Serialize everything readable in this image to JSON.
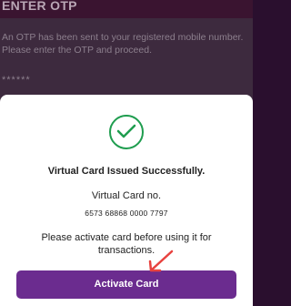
{
  "background": {
    "title": "ENTER OTP",
    "message": "An OTP has been sent to your registered mobile number. Please enter the OTP and proceed.",
    "otp_mask": "******"
  },
  "dialog": {
    "icon": "check-circle-icon",
    "success_title": "Virtual Card Issued Successfully.",
    "card_label": "Virtual Card no.",
    "card_number": "6573 68868 0000 7797",
    "note": "Please activate card before using it for transactions.",
    "activate_label": "Activate Card"
  },
  "colors": {
    "accent": "#6b2c8f",
    "success": "#1f9d4f",
    "annotation_arrow": "#e8423f"
  }
}
